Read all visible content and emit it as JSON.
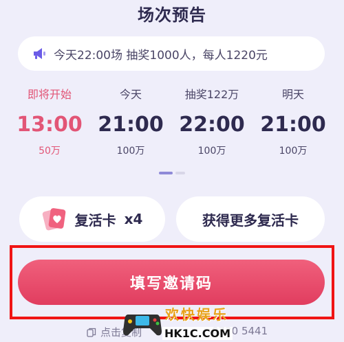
{
  "header": {
    "title": "场次预告"
  },
  "announcement": {
    "icon": "megaphone-icon",
    "text": "今天22:00场 抽奖1000人，每人1220元"
  },
  "schedule": [
    {
      "label": "即将开始",
      "time": "13:00",
      "prize": "50万",
      "active": true
    },
    {
      "label": "今天",
      "time": "21:00",
      "prize": "100万",
      "active": false
    },
    {
      "label": "抽奖122万",
      "time": "22:00",
      "prize": "100万",
      "active": false
    },
    {
      "label": "明天",
      "time": "21:00",
      "prize": "100万",
      "active": false
    }
  ],
  "revive_card": {
    "icon": "heart-card-icon",
    "label": "复活卡",
    "count": "x4"
  },
  "more_cards_button": {
    "label": "获得更多复活卡"
  },
  "cta": {
    "label": "填写邀请码"
  },
  "footer": {
    "copy_hint": "点击复制",
    "invite_code": "0720 5441"
  },
  "watermark": {
    "title": "欢快娱乐",
    "url": "HK1C.COM"
  },
  "colors": {
    "background": "#efeefa",
    "accent": "#e13d5f",
    "active_slot": "#e25576",
    "highlight_box": "#f01414",
    "indicator": "#8f8ad8"
  }
}
